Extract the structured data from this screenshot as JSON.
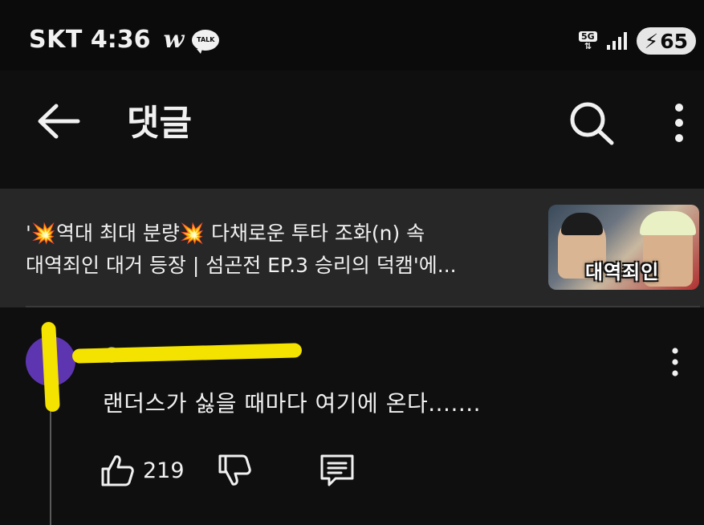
{
  "status_bar": {
    "carrier": "SKT",
    "time": "4:36",
    "app_icon_w": "w",
    "talk_icon_label": "TALK",
    "network_label": "5G",
    "battery": "65",
    "icons": [
      "webtoon-icon",
      "kakaotalk-icon",
      "5g-network-icon",
      "signal-icon",
      "battery-charging-icon"
    ]
  },
  "app_bar": {
    "title": "댓글",
    "icons": [
      "back-arrow-icon",
      "search-icon",
      "more-vert-icon"
    ]
  },
  "video": {
    "title_line1": "'💥역대 최대 분량💥 다채로운 투타 조화(n) 속",
    "title_line2": "대역죄인 대거 등장 | 섬곤전 EP.3 승리의 덕캠'에...",
    "thumbnail_text": "대역죄인"
  },
  "comment": {
    "avatar_letter": "i",
    "author_meta": "@···········  ·· ·",
    "text": "랜더스가 싫을 때마다 여기에 온다.......",
    "like_count": "219",
    "icons": [
      "like-icon",
      "dislike-icon",
      "reply-icon",
      "more-vert-icon"
    ]
  },
  "colors": {
    "background": "#0f0f0f",
    "card": "#272727",
    "avatar": "#5e35b1",
    "redaction": "#f4e300",
    "text": "#f1f1f1"
  }
}
